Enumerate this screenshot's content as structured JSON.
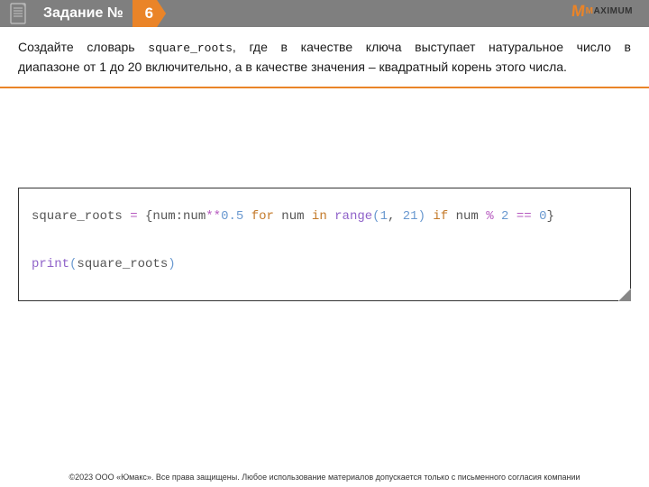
{
  "header": {
    "label": "Задание №",
    "number": "6"
  },
  "logo": {
    "word": "MAXIMUM"
  },
  "task": {
    "line1_a": "Создайте словарь ",
    "line1_code": "square_roots",
    "line1_b": ", где в качестве ключа выступает натуральное число в",
    "line2": "диапазоне от 1 до 20 включительно, а в качестве значения – квадратный корень этого числа."
  },
  "code": {
    "t1": "square_roots ",
    "op1": "=",
    "t2": " {num:num",
    "op2": "**",
    "num1": "0.5",
    "sp1": " ",
    "kw1": "for",
    "t3": " num ",
    "kw2": "in",
    "sp2": " ",
    "fn1": "range",
    "p1": "(",
    "num2": "1",
    "t4": ", ",
    "num3": "21",
    "p2": ")",
    "sp3": " ",
    "kw3": "if",
    "t5": " num ",
    "op3": "%",
    "sp4": " ",
    "num4": "2",
    "sp5": " ",
    "op4": "==",
    "sp6": " ",
    "num5": "0",
    "t6": "}",
    "fn2": "print",
    "p3": "(",
    "t7": "square_roots",
    "p4": ")"
  },
  "footer": "©2023 ООО «Юмакс». Все права защищены. Любое использование материалов допускается только с письменного согласия компании"
}
